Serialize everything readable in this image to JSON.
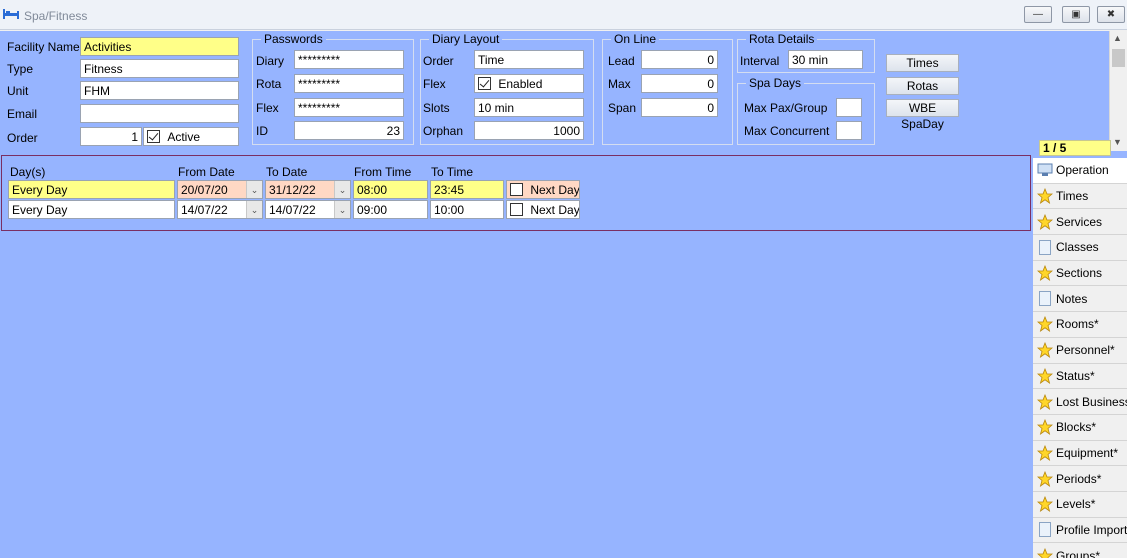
{
  "window": {
    "title": "Spa/Fitness"
  },
  "facility": {
    "name_label": "Facility Name",
    "name_value": "Activities",
    "type_label": "Type",
    "type_value": "Fitness",
    "unit_label": "Unit",
    "unit_value": "FHM",
    "email_label": "Email",
    "email_value": "",
    "order_label": "Order",
    "order_value": "1",
    "active_label": "Active"
  },
  "passwords": {
    "title": "Passwords",
    "diary_label": "Diary",
    "diary_value": "*********",
    "rota_label": "Rota",
    "rota_value": "*********",
    "flex_label": "Flex",
    "flex_value": "*********",
    "id_label": "ID",
    "id_value": "23"
  },
  "diary_layout": {
    "title": "Diary Layout",
    "order_label": "Order",
    "order_value": "Time",
    "flex_label": "Flex",
    "flex_check_label": "Enabled",
    "slots_label": "Slots",
    "slots_value": "10 min",
    "orphan_label": "Orphan",
    "orphan_value": "1000"
  },
  "online": {
    "title": "On Line",
    "lead_label": "Lead",
    "lead_value": "0",
    "max_label": "Max",
    "max_value": "0",
    "span_label": "Span",
    "span_value": "0"
  },
  "rota": {
    "title": "Rota Details",
    "interval_label": "Interval",
    "interval_value": "30 min"
  },
  "spa_days": {
    "title": "Spa Days",
    "max_pax_label": "Max Pax/Group",
    "max_pax_value": "",
    "max_concurrent_label": "Max Concurrent",
    "max_concurrent_value": ""
  },
  "buttons": {
    "times": "Times",
    "rotas": "Rotas",
    "wbe": "WBE SpaDay"
  },
  "pager": "1 / 5",
  "grid": {
    "headers": [
      "Day(s)",
      "From Date",
      "To Date",
      "From Time",
      "To Time"
    ],
    "rows": [
      {
        "days": "Every Day",
        "from_date": "20/07/20",
        "to_date": "31/12/22",
        "from_time": "08:00",
        "to_time": "23:45",
        "next_day": "Next Day"
      },
      {
        "days": "Every Day",
        "from_date": "14/07/22",
        "to_date": "14/07/22",
        "from_time": "09:00",
        "to_time": "10:00",
        "next_day": "Next Day"
      }
    ]
  },
  "sidebar": {
    "items": [
      {
        "label": "Operation",
        "icon": "operation-icon"
      },
      {
        "label": "Times",
        "icon": "star-icon"
      },
      {
        "label": "Services",
        "icon": "star-icon"
      },
      {
        "label": "Classes",
        "icon": "page-icon"
      },
      {
        "label": "Sections",
        "icon": "star-icon"
      },
      {
        "label": "Notes",
        "icon": "page-icon"
      },
      {
        "label": "Rooms*",
        "icon": "star-icon"
      },
      {
        "label": "Personnel*",
        "icon": "star-icon"
      },
      {
        "label": "Status*",
        "icon": "star-icon"
      },
      {
        "label": "Lost Business*",
        "icon": "star-icon"
      },
      {
        "label": "Blocks*",
        "icon": "star-icon"
      },
      {
        "label": "Equipment*",
        "icon": "star-icon"
      },
      {
        "label": "Periods*",
        "icon": "star-icon"
      },
      {
        "label": "Levels*",
        "icon": "star-icon"
      },
      {
        "label": "Profile Import",
        "icon": "page-icon"
      },
      {
        "label": "Groups*",
        "icon": "star-icon"
      }
    ]
  },
  "colors": {
    "background": "#96b4ff",
    "highlight": "#ffff88",
    "peach": "#ffd8c4",
    "grid_border": "#7a2f63"
  }
}
